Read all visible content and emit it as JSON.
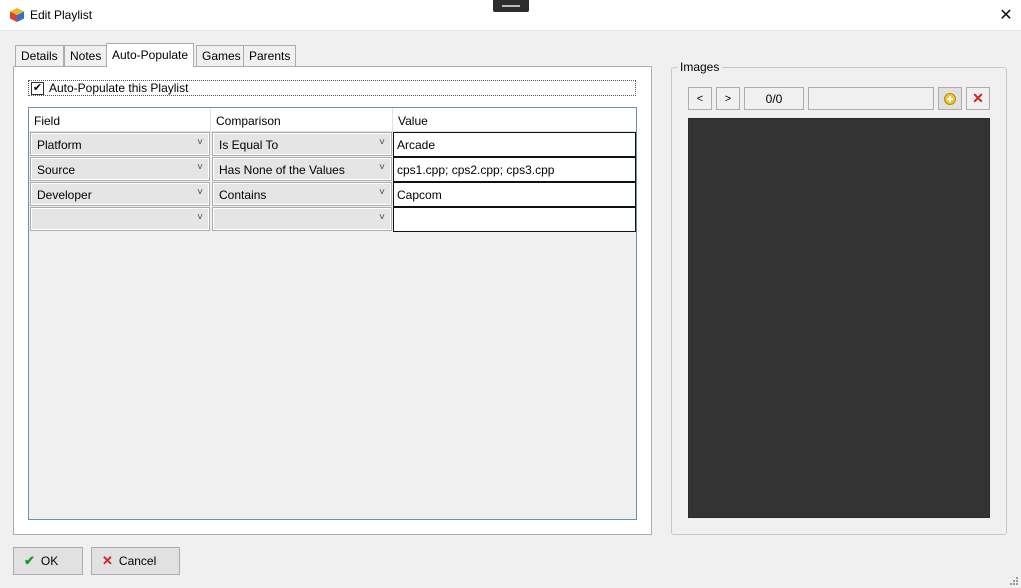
{
  "window": {
    "title": "Edit Playlist",
    "close_glyph": "✕"
  },
  "tabs": [
    {
      "label": "Details"
    },
    {
      "label": "Notes"
    },
    {
      "label": "Auto-Populate"
    },
    {
      "label": "Games"
    },
    {
      "label": "Parents"
    }
  ],
  "auto_populate": {
    "checkbox_label": "Auto-Populate this Playlist",
    "checked": true,
    "check_glyph": "✔"
  },
  "grid": {
    "headers": [
      "Field",
      "Comparison",
      "Value"
    ],
    "rows": [
      {
        "field": "Platform",
        "comparison": "Is Equal To",
        "value": "Arcade"
      },
      {
        "field": "Source",
        "comparison": "Has None of the Values",
        "value": "cps1.cpp; cps2.cpp; cps3.cpp"
      },
      {
        "field": "Developer",
        "comparison": "Contains",
        "value": "Capcom"
      },
      {
        "field": "",
        "comparison": "",
        "value": ""
      }
    ],
    "dropdown_glyph": "˅"
  },
  "images": {
    "legend": "Images",
    "prev_label": "<",
    "next_label": ">",
    "counter": "0/0",
    "add_icon": "plus-icon",
    "delete_glyph": "✕"
  },
  "footer": {
    "ok_label": "OK",
    "ok_glyph": "✔",
    "cancel_label": "Cancel",
    "cancel_glyph": "✕"
  },
  "colors": {
    "accent_green": "#1a9a2a",
    "delete_red": "#d62020",
    "preview_bg": "#333333"
  }
}
